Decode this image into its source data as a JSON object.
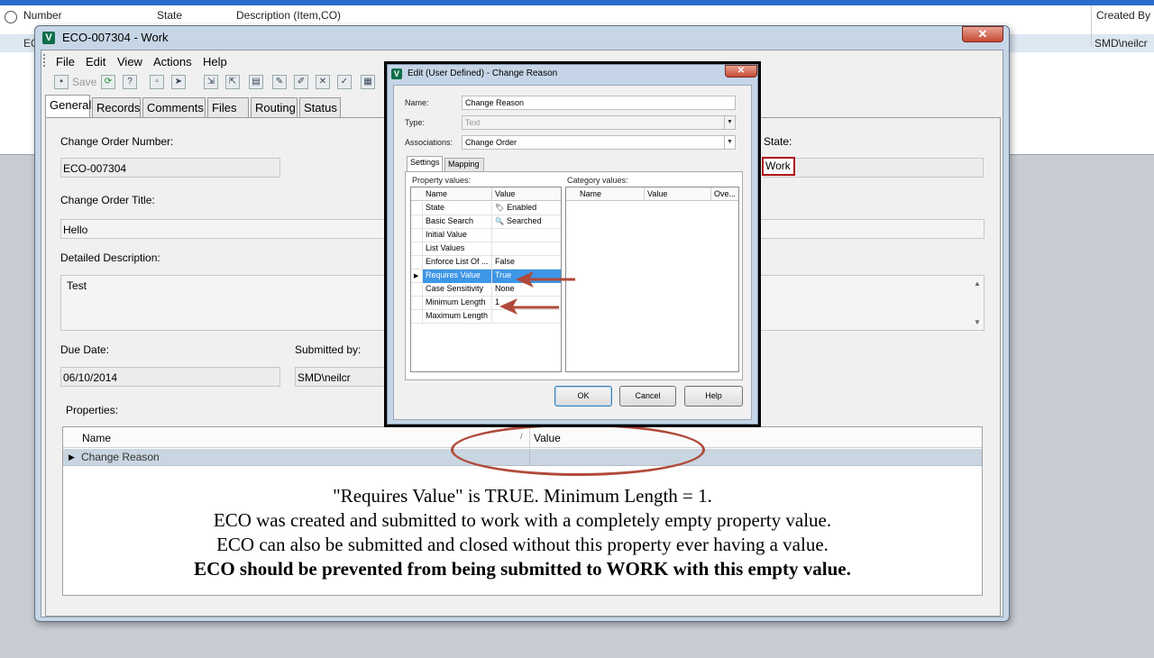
{
  "background_list": {
    "columns": [
      "Number",
      "State",
      "Description (Item,CO)",
      "Created By"
    ],
    "row": {
      "number_fragment": "EC",
      "created_by": "SMD\\neilcr"
    }
  },
  "eco_window": {
    "title": "ECO-007304 - Work",
    "close_glyph": "✕",
    "menu": [
      "File",
      "Edit",
      "View",
      "Actions",
      "Help"
    ],
    "toolbar": {
      "save_label": "Save"
    },
    "tabs": [
      "General",
      "Records",
      "Comments",
      "Files",
      "Routing",
      "Status"
    ],
    "active_tab": "General",
    "form": {
      "change_order_number_label": "Change Order Number:",
      "change_order_number": "ECO-007304",
      "state_label": "State:",
      "state": "Work",
      "change_order_title_label": "Change Order Title:",
      "change_order_title": "Hello",
      "detailed_description_label": "Detailed Description:",
      "detailed_description": "Test",
      "due_date_label": "Due Date:",
      "due_date": "06/10/2014",
      "submitted_by_label": "Submitted by:",
      "submitted_by": "SMD\\neilcr",
      "properties_label": "Properties:"
    },
    "properties_grid": {
      "columns": [
        "Name",
        "Value"
      ],
      "rows": [
        {
          "name": "Change Reason",
          "value": ""
        }
      ]
    }
  },
  "annotation": {
    "line1": "\"Requires Value\" is TRUE.  Minimum Length = 1.",
    "line2": "ECO was created and submitted to work with a completely empty property value.",
    "line3": "ECO can also be submitted and closed without this property ever having a value.",
    "line4": "ECO should be prevented from being submitted to WORK with this empty value."
  },
  "dialog": {
    "title": "Edit (User Defined) - Change Reason",
    "close_glyph": "✕",
    "name_label": "Name:",
    "name_value": "Change Reason",
    "type_label": "Type:",
    "type_value": "Text",
    "associations_label": "Associations:",
    "associations_value": "Change Order",
    "tabs": [
      "Settings",
      "Mapping"
    ],
    "active_tab": "Settings",
    "property_values_label": "Property values:",
    "category_values_label": "Category values:",
    "property_columns": [
      "Name",
      "Value"
    ],
    "category_columns": [
      "Name",
      "Value",
      "Ove..."
    ],
    "properties": [
      {
        "name": "State",
        "value": "Enabled",
        "icon": "tag-icon"
      },
      {
        "name": "Basic Search",
        "value": "Searched",
        "icon": "magnifier-icon"
      },
      {
        "name": "Initial Value",
        "value": ""
      },
      {
        "name": "List Values",
        "value": ""
      },
      {
        "name": "Enforce List Of ...",
        "value": "False"
      },
      {
        "name": "Requires Value",
        "value": "True",
        "selected": true
      },
      {
        "name": "Case Sensitivity",
        "value": "None"
      },
      {
        "name": "Minimum Length",
        "value": "1"
      },
      {
        "name": "Maximum Length",
        "value": ""
      }
    ],
    "buttons": {
      "ok": "OK",
      "cancel": "Cancel",
      "help": "Help"
    }
  },
  "colors": {
    "highlight_red": "#b0121a",
    "annotation_red": "#b04a3a",
    "selection_blue": "#3d96e6",
    "row_blue": "#c9d5e0"
  }
}
